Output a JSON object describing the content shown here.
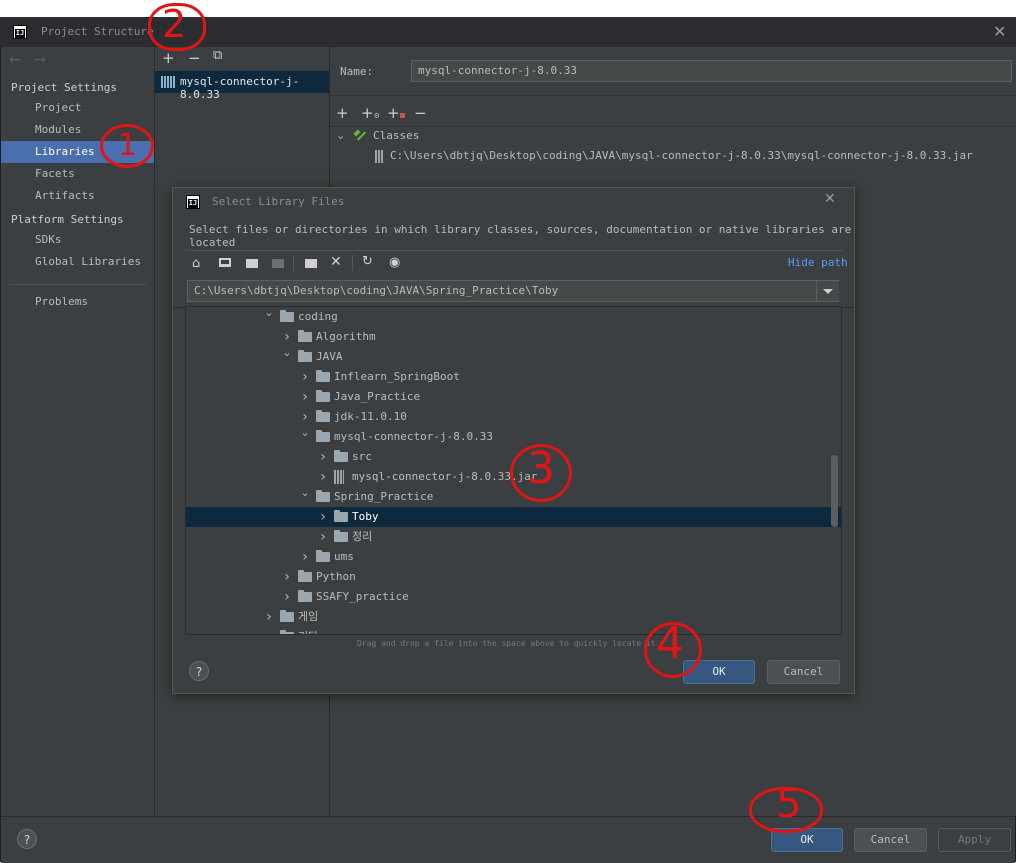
{
  "window": {
    "title": "Project Structure",
    "logo": "IJ"
  },
  "nav": {
    "back_icon": "←",
    "forward_icon": "→"
  },
  "sidebar": {
    "project_settings_title": "Project Settings",
    "project_items": [
      {
        "label": "Project"
      },
      {
        "label": "Modules"
      },
      {
        "label": "Libraries",
        "selected": true
      },
      {
        "label": "Facets"
      },
      {
        "label": "Artifacts"
      }
    ],
    "platform_settings_title": "Platform Settings",
    "platform_items": [
      {
        "label": "SDKs"
      },
      {
        "label": "Global Libraries"
      }
    ],
    "problems_label": "Problems"
  },
  "libraries": {
    "toolbar": {
      "add": "+",
      "remove": "−",
      "copy": "⧉"
    },
    "items": [
      {
        "label": "mysql-connector-j-8.0.33"
      }
    ]
  },
  "details": {
    "name_label": "Name:",
    "name_value": "mysql-connector-j-8.0.33",
    "toolbar": {
      "add": "+",
      "add_special": "+",
      "add_excluded": "+",
      "remove": "−"
    },
    "classes_label": "Classes",
    "classes_path": "C:\\Users\\dbtjq\\Desktop\\coding\\JAVA\\mysql-connector-j-8.0.33\\mysql-connector-j-8.0.33.jar"
  },
  "dialog": {
    "title": "Select Library Files",
    "description": "Select files or directories in which library classes, sources, documentation or native libraries are located",
    "hide_path": "Hide path",
    "path_value": "C:\\Users\\dbtjq\\Desktop\\coding\\JAVA\\Spring_Practice\\Toby",
    "tree": [
      {
        "label": "coding",
        "depth": 0,
        "expanded": true,
        "icon": "folder"
      },
      {
        "label": "Algorithm",
        "depth": 1,
        "expanded": false,
        "icon": "folder"
      },
      {
        "label": "JAVA",
        "depth": 1,
        "expanded": true,
        "icon": "folder"
      },
      {
        "label": "Inflearn_SpringBoot",
        "depth": 2,
        "expanded": false,
        "icon": "folder"
      },
      {
        "label": "Java_Practice",
        "depth": 2,
        "expanded": false,
        "icon": "folder"
      },
      {
        "label": "jdk-11.0.10",
        "depth": 2,
        "expanded": false,
        "icon": "folder"
      },
      {
        "label": "mysql-connector-j-8.0.33",
        "depth": 2,
        "expanded": true,
        "icon": "folder"
      },
      {
        "label": "src",
        "depth": 3,
        "expanded": false,
        "icon": "folder"
      },
      {
        "label": "mysql-connector-j-8.0.33.jar",
        "depth": 3,
        "expanded": false,
        "icon": "jar"
      },
      {
        "label": "Spring_Practice",
        "depth": 2,
        "expanded": true,
        "icon": "folder"
      },
      {
        "label": "Toby",
        "depth": 3,
        "expanded": false,
        "icon": "folder",
        "selected": true
      },
      {
        "label": "정리",
        "depth": 3,
        "expanded": false,
        "icon": "folder"
      },
      {
        "label": "ums",
        "depth": 2,
        "expanded": false,
        "icon": "folder"
      },
      {
        "label": "Python",
        "depth": 1,
        "expanded": false,
        "icon": "folder"
      },
      {
        "label": "SSAFY_practice",
        "depth": 1,
        "expanded": false,
        "icon": "folder"
      },
      {
        "label": "게임",
        "depth": 0,
        "expanded": false,
        "icon": "folder"
      },
      {
        "label": "기타",
        "depth": 0,
        "expanded": false,
        "icon": "folder"
      }
    ],
    "drag_hint": "Drag and drop a file into the space above to quickly locate it",
    "ok": "OK",
    "cancel": "Cancel",
    "help": "?"
  },
  "footer": {
    "ok": "OK",
    "cancel": "Cancel",
    "apply": "Apply",
    "help": "?"
  },
  "annotations": [
    "1",
    "2",
    "3",
    "4",
    "5"
  ],
  "colors": {
    "accent": "#4b6eaf",
    "selection_dark": "#0d293e",
    "link": "#589df6",
    "annotation_red": "#e01515"
  }
}
